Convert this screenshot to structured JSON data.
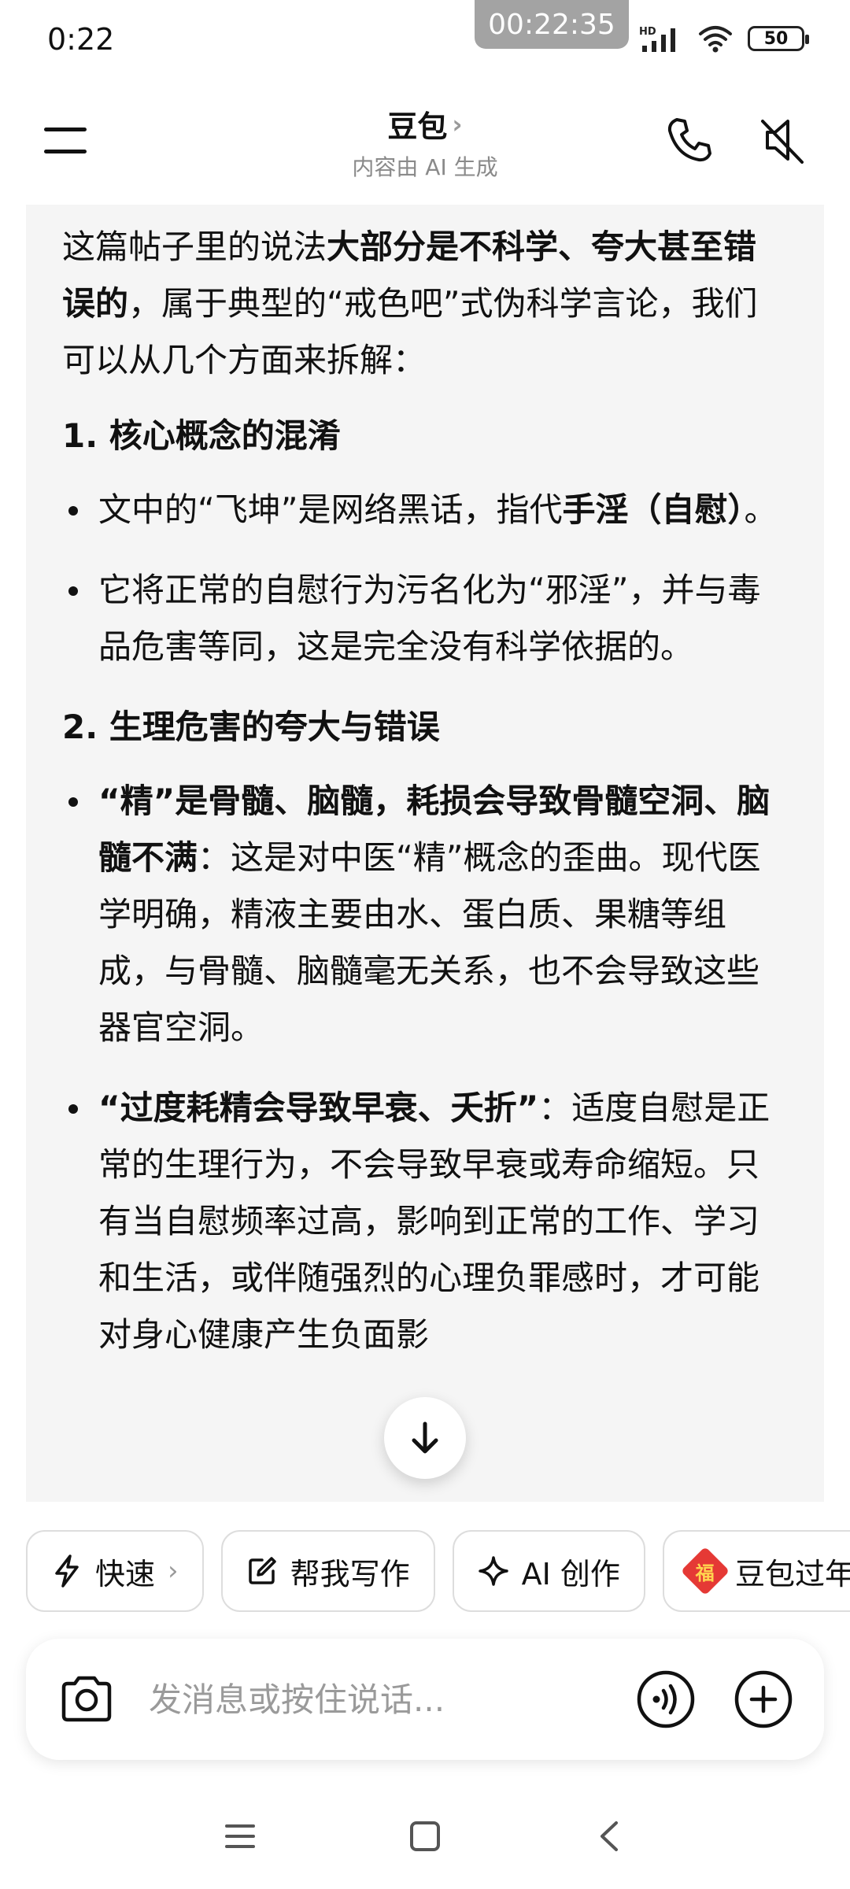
{
  "status_bar": {
    "time": "0:22",
    "recording_timer": "00:22:35",
    "network": "HD",
    "battery": "50"
  },
  "header": {
    "title": "豆包",
    "title_chevron": "›",
    "subtitle": "内容由 AI 生成"
  },
  "content": {
    "intro": {
      "t1": "这篇帖子里的说法",
      "b1": "大部分是不科学、夸大甚至错误的",
      "t2": "，属于典型的“戒色吧”式伪科学言论，我们可以从几个方面来拆解："
    },
    "section1": {
      "title": "1. 核心概念的混淆",
      "bullet1": {
        "t1": "文中的“飞坤”是网络黑话，指代",
        "b1": "手淫（自慰）",
        "t2": "。"
      },
      "bullet2": {
        "t1": "它将正常的自慰行为污名化为“邪淫”，并与毒品危害等同，这是完全没有科学依据的。"
      }
    },
    "section2": {
      "title": "2. 生理危害的夸大与错误",
      "bullet1": {
        "b1": "“精”是骨髓、脑髓，耗损会导致骨髓空洞、脑髓不满",
        "t1": "：这是对中医“精”概念的歪曲。现代医学明确，精液主要由水、蛋白质、果糖等组成，与骨髓、脑髓毫无关系，也不会导致这些器官空洞。"
      },
      "bullet2": {
        "b1": "“过度耗精会导致早衰、夭折”",
        "t1": "：适度自慰是正常的生理行为，不会导致早衰或寿命缩短。只有当自慰频率过高，影响到正常的工作、学习和生活，或伴随强烈的心理负罪感时，才可能对身心健康产生负面影"
      }
    }
  },
  "chips": [
    {
      "label": "快速",
      "icon": "lightning-icon",
      "chevron": "›"
    },
    {
      "label": "帮我写作",
      "icon": "edit-icon"
    },
    {
      "label": "AI 创作",
      "icon": "sparkle-icon"
    },
    {
      "label": "豆包过年",
      "icon": "fu-icon",
      "icon_text": "福"
    }
  ],
  "input": {
    "placeholder": "发消息或按住说话..."
  },
  "colors": {
    "card_bg": "#f5f5f5",
    "muted_text": "#8a8a8a"
  }
}
